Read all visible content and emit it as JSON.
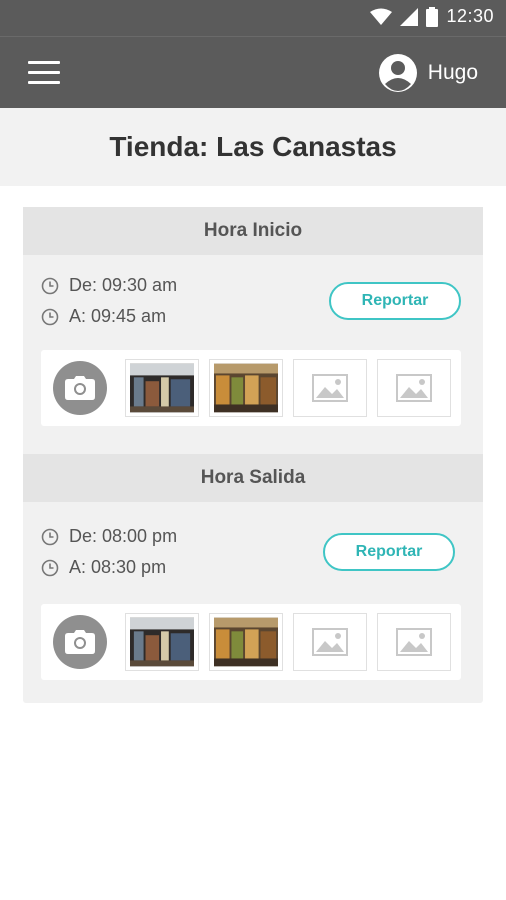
{
  "status_bar": {
    "time": "12:30"
  },
  "app_bar": {
    "user_name": "Hugo"
  },
  "page": {
    "title": "Tienda: Las Canastas"
  },
  "sections": [
    {
      "header": "Hora Inicio",
      "from": "De: 09:30 am",
      "to": "A: 09:45 am",
      "report_label": "Reportar"
    },
    {
      "header": "Hora Salida",
      "from": "De: 08:00 pm",
      "to": "A: 08:30 pm",
      "report_label": "Reportar"
    }
  ],
  "icons": {
    "menu": "hamburger-icon",
    "user": "account-circle-icon",
    "clock": "clock-icon",
    "camera": "camera-icon",
    "placeholder": "image-placeholder-icon"
  },
  "colors": {
    "app_bar": "#5b5b5b",
    "accent": "#3fc5c5",
    "card": "#f1f1f1",
    "section_header": "#e4e4e4"
  }
}
